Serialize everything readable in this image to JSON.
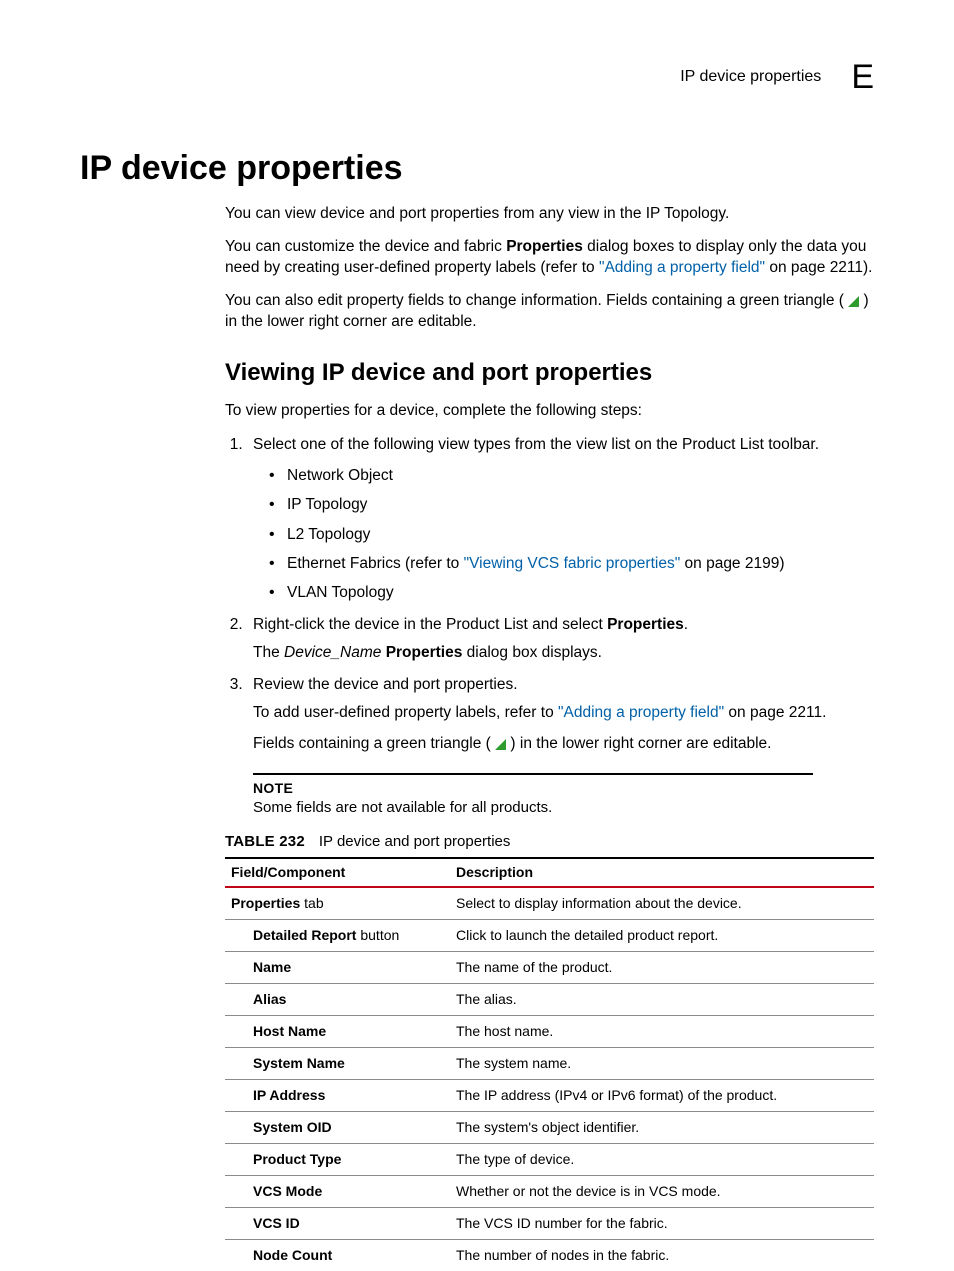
{
  "runhead": {
    "title": "IP device properties",
    "letter": "E"
  },
  "h1": "IP device properties",
  "intro": {
    "p1": "You can view device and port properties from any view in the IP Topology.",
    "p2a": "You can customize the device and fabric ",
    "p2b": "Properties",
    "p2c": " dialog boxes to display only the data you need by creating user-defined property labels (refer to ",
    "p2_link": "\"Adding a property field\"",
    "p2d": " on page 2211).",
    "p3a": "You can also edit property fields to change information. Fields containing a green triangle ( ",
    "p3b": " ) in the lower right corner are editable."
  },
  "h2": "Viewing IP device and port properties",
  "lead": "To view properties for a device, complete the following steps:",
  "steps": {
    "s1": "Select one of the following view types from the view list on the Product List toolbar.",
    "bullets": {
      "b1": "Network Object",
      "b2": "IP Topology",
      "b3": "L2 Topology",
      "b4a": "Ethernet Fabrics (refer to ",
      "b4_link": "\"Viewing VCS fabric properties\"",
      "b4b": " on page 2199)",
      "b5": "VLAN Topology"
    },
    "s2a": "Right-click the device in the Product List and select ",
    "s2b": "Properties",
    "s2c": ".",
    "s2body_a": "The ",
    "s2body_b": "Device_Name",
    "s2body_c": " ",
    "s2body_d": "Properties",
    "s2body_e": " dialog box displays.",
    "s3": "Review the device and port properties.",
    "s3body1a": "To add user-defined property labels, refer to ",
    "s3body1_link": "\"Adding a property field\"",
    "s3body1b": " on page 2211.",
    "s3body2a": "Fields containing a green triangle ( ",
    "s3body2b": " ) in the lower right corner are editable."
  },
  "note": {
    "label": "NOTE",
    "text": "Some fields are not available for all products."
  },
  "table": {
    "label": "TABLE 232",
    "caption": "IP device and port properties",
    "head": {
      "c1": "Field/Component",
      "c2": "Description"
    },
    "rows": [
      {
        "f_bold": "Properties",
        "f_rest": " tab",
        "indent": false,
        "d": "Select to display information about the device."
      },
      {
        "f_bold": "Detailed Report",
        "f_rest": " button",
        "indent": true,
        "d": "Click to launch the detailed product report."
      },
      {
        "f_bold": "Name",
        "f_rest": "",
        "indent": true,
        "d": "The name of the product."
      },
      {
        "f_bold": "Alias",
        "f_rest": "",
        "indent": true,
        "d": "The alias."
      },
      {
        "f_bold": "Host Name",
        "f_rest": "",
        "indent": true,
        "d": "The host name."
      },
      {
        "f_bold": "System Name",
        "f_rest": "",
        "indent": true,
        "d": "The system name."
      },
      {
        "f_bold": "IP Address",
        "f_rest": "",
        "indent": true,
        "d": "The IP address (IPv4 or IPv6 format) of the product."
      },
      {
        "f_bold": "System OID",
        "f_rest": "",
        "indent": true,
        "d": "The system's object identifier."
      },
      {
        "f_bold": "Product Type",
        "f_rest": "",
        "indent": true,
        "d": "The type of device."
      },
      {
        "f_bold": "VCS Mode",
        "f_rest": "",
        "indent": true,
        "d": "Whether or not the device is in VCS mode."
      },
      {
        "f_bold": "VCS ID",
        "f_rest": "",
        "indent": true,
        "d": "The VCS ID number for the fabric."
      },
      {
        "f_bold": "Node Count",
        "f_rest": "",
        "indent": true,
        "d": "The number of nodes in the fabric."
      }
    ]
  }
}
